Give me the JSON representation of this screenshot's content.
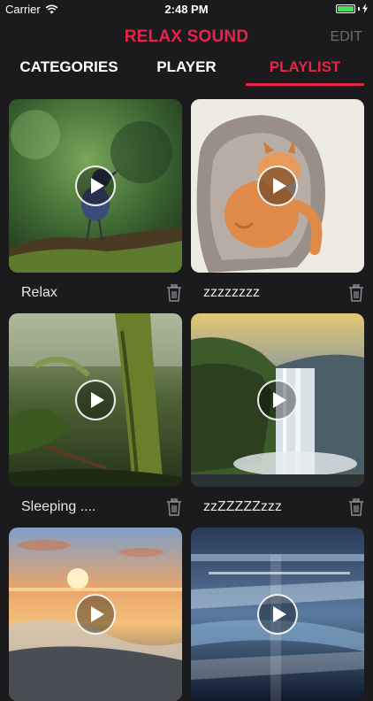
{
  "status_bar": {
    "carrier": "Carrier",
    "time": "2:48 PM",
    "battery_level": 1.0
  },
  "header": {
    "title": "RELAX SOUND",
    "edit_label": "EDIT"
  },
  "tabs": [
    {
      "label": "CATEGORIES",
      "active": false
    },
    {
      "label": "PLAYER",
      "active": false
    },
    {
      "label": "PLAYLIST",
      "active": true
    }
  ],
  "colors": {
    "accent": "#e8234a",
    "background": "#1b1b1d",
    "muted": "#6c6c70",
    "battery": "#4cd964"
  },
  "playlist": [
    {
      "label": "Relax",
      "image": "bird-in-forest"
    },
    {
      "label": "zzzzzzzz",
      "image": "cat-in-bed"
    },
    {
      "label": "Sleeping ....",
      "image": "rainforest"
    },
    {
      "label": "zzZZZZZzzz",
      "image": "waterfall"
    },
    {
      "label": "",
      "image": "sunset-beach"
    },
    {
      "label": "",
      "image": "abstract-water"
    }
  ],
  "icons": {
    "play": "play-icon",
    "delete": "trash-icon",
    "wifi": "wifi-icon",
    "battery": "battery-icon",
    "charging": "bolt-icon"
  }
}
